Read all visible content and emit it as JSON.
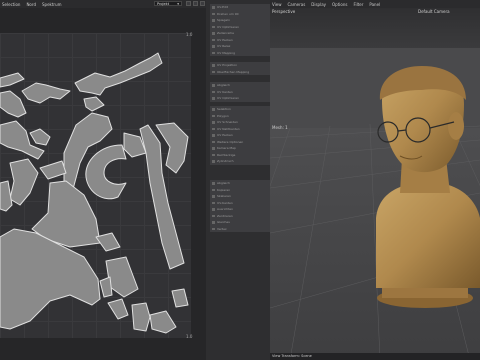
{
  "uv_editor": {
    "menu": [
      "Selection",
      "Nord",
      "Spektrum"
    ],
    "project_select": "Projekt",
    "corner_top": "1.0",
    "corner_bottom": "1.0"
  },
  "settings": {
    "groups": [
      [
        "UV-Edit",
        "Drehen um 90",
        "Spiegeln",
        "UV Optimieren",
        "Zellenreihe",
        "UV Packen",
        "UV Relax",
        "UV Mapping"
      ],
      [
        "UV Projektion",
        "Oberflächen Mapping"
      ],
      [
        "Abgleich",
        "UV Kanten",
        "UV Optimieren"
      ],
      [
        "Selektion",
        "Polygon",
        "UV Schneiden",
        "UV Nahtkanten",
        "UV Packen",
        "Weitere Optionen",
        "Kamera Map",
        "Rechteckige",
        "Zylindrisch"
      ],
      [
        "Abgleich",
        "Kopieren",
        "Skalieren",
        "UV-Kanten",
        "Ausrichten",
        "Zentrieren",
        "Gleiches",
        "Vertex"
      ]
    ]
  },
  "viewport": {
    "menu": [
      "View",
      "Cameras",
      "Display",
      "Options",
      "Filter",
      "Panel"
    ],
    "view_label": "Perspective",
    "camera_label": "Default Camera",
    "axis_label": "Mesh: 1",
    "status": "View Transform: Scene"
  },
  "colors": {
    "uv_shell": "#8a8a8a",
    "uv_outline": "#e0e0e0",
    "bust": "#b0894d"
  }
}
